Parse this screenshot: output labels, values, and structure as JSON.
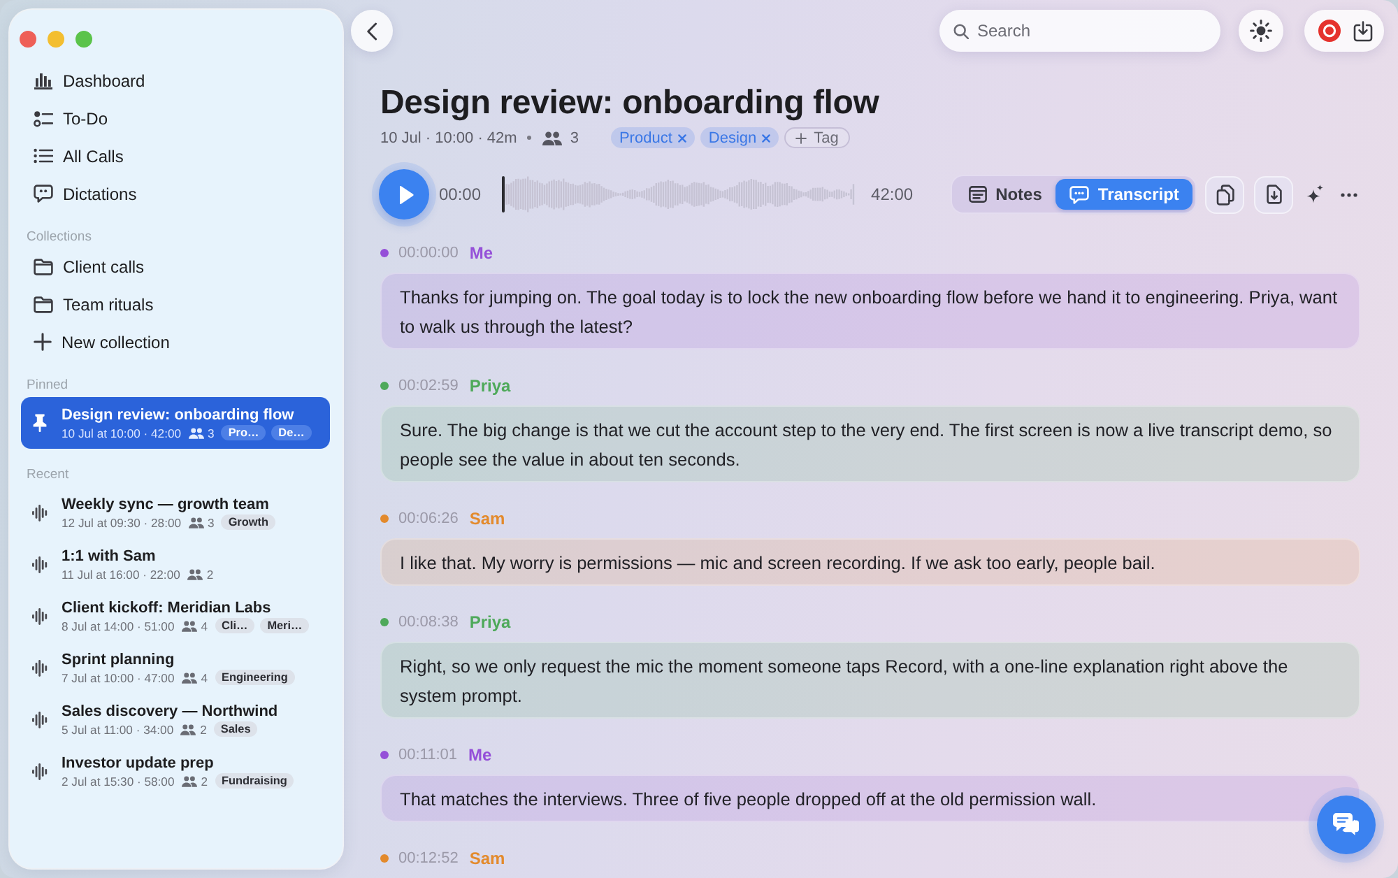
{
  "sidebar": {
    "nav": [
      {
        "label": "Dashboard",
        "selected": false
      },
      {
        "label": "To-Do",
        "selected": false
      },
      {
        "label": "All Calls",
        "selected": false
      },
      {
        "label": "Dictations",
        "selected": false
      }
    ],
    "collections": {
      "heading": "Collections",
      "items": [
        {
          "label": "Client calls",
          "selected": false
        },
        {
          "label": "Team rituals",
          "selected": false
        }
      ],
      "new_button": "New collection"
    },
    "pinned": {
      "heading": "Pinned",
      "items": [
        {
          "title": "Design review: onboarding flow",
          "meta": "10 Jul at 10:00 · 42:00",
          "participants": "3",
          "tags": [
            "Pro…",
            "De…"
          ],
          "selected": true
        }
      ]
    },
    "recent": {
      "heading": "Recent",
      "items": [
        {
          "title": "Weekly sync — growth team",
          "meta": "12 Jul at 09:30 · 28:00",
          "participants": "3",
          "tags": [
            "Growth"
          ],
          "selected": false
        },
        {
          "title": "1:1 with Sam",
          "meta": "11 Jul at 16:00 · 22:00",
          "participants": "2",
          "selected": false
        },
        {
          "title": "Client kickoff: Meridian Labs",
          "meta": "8 Jul at 14:00 · 51:00",
          "participants": "4",
          "tags": [
            "Cli…",
            "Meri…"
          ],
          "selected": false
        },
        {
          "title": "Sprint planning",
          "meta": "7 Jul at 10:00 · 47:00",
          "participants": "4",
          "tags": [
            "Engineering"
          ],
          "selected": false
        },
        {
          "title": "Sales discovery — Northwind",
          "meta": "5 Jul at 11:00 · 34:00",
          "participants": "2",
          "tags": [
            "Sales"
          ],
          "selected": false
        },
        {
          "title": "Investor update prep",
          "meta": "2 Jul at 15:30 · 58:00",
          "participants": "2",
          "tags": [
            "Fundraising"
          ],
          "selected": false
        }
      ]
    }
  },
  "toolbar": {
    "search": {
      "placeholder": "Search"
    }
  },
  "call": {
    "title": "Design review: onboarding flow",
    "meta": "10 Jul · 10:00 · 42m",
    "participants": "3",
    "tags": [
      "Product",
      "Design"
    ],
    "add_tag": "Tag"
  },
  "player": {
    "playing": false,
    "elapsed": "00:00",
    "level": 0,
    "duration": "42:00"
  },
  "views": [
    {
      "label": "Notes",
      "selected": false
    },
    {
      "label": "Transcript",
      "selected": true
    }
  ],
  "transcript": [
    {
      "time": "00:00:00",
      "speaker": "Me",
      "color": "#9550d8",
      "text": "Thanks for jumping on. The goal today is to lock the new onboarding flow before we hand it to engineering. Priya, want to walk us through the latest?"
    },
    {
      "time": "00:02:59",
      "speaker": "Priya",
      "color": "#4ea95a",
      "text": "Sure. The big change is that we cut the account step to the very end. The first screen is now a live transcript demo, so people see the value in about ten seconds."
    },
    {
      "time": "00:06:26",
      "speaker": "Sam",
      "color": "#e38a2c",
      "text": "I like that. My worry is permissions — mic and screen recording. If we ask too early, people bail."
    },
    {
      "time": "00:08:38",
      "speaker": "Priya",
      "color": "#4ea95a",
      "text": "Right, so we only request the mic the moment someone taps Record, with a one-line explanation right above the system prompt."
    },
    {
      "time": "00:11:01",
      "speaker": "Me",
      "color": "#9550d8",
      "text": "That matches the interviews. Three of five people dropped off at the old permission wall."
    },
    {
      "time": "00:12:52",
      "speaker": "Sam",
      "color": "#e38a2c"
    }
  ]
}
